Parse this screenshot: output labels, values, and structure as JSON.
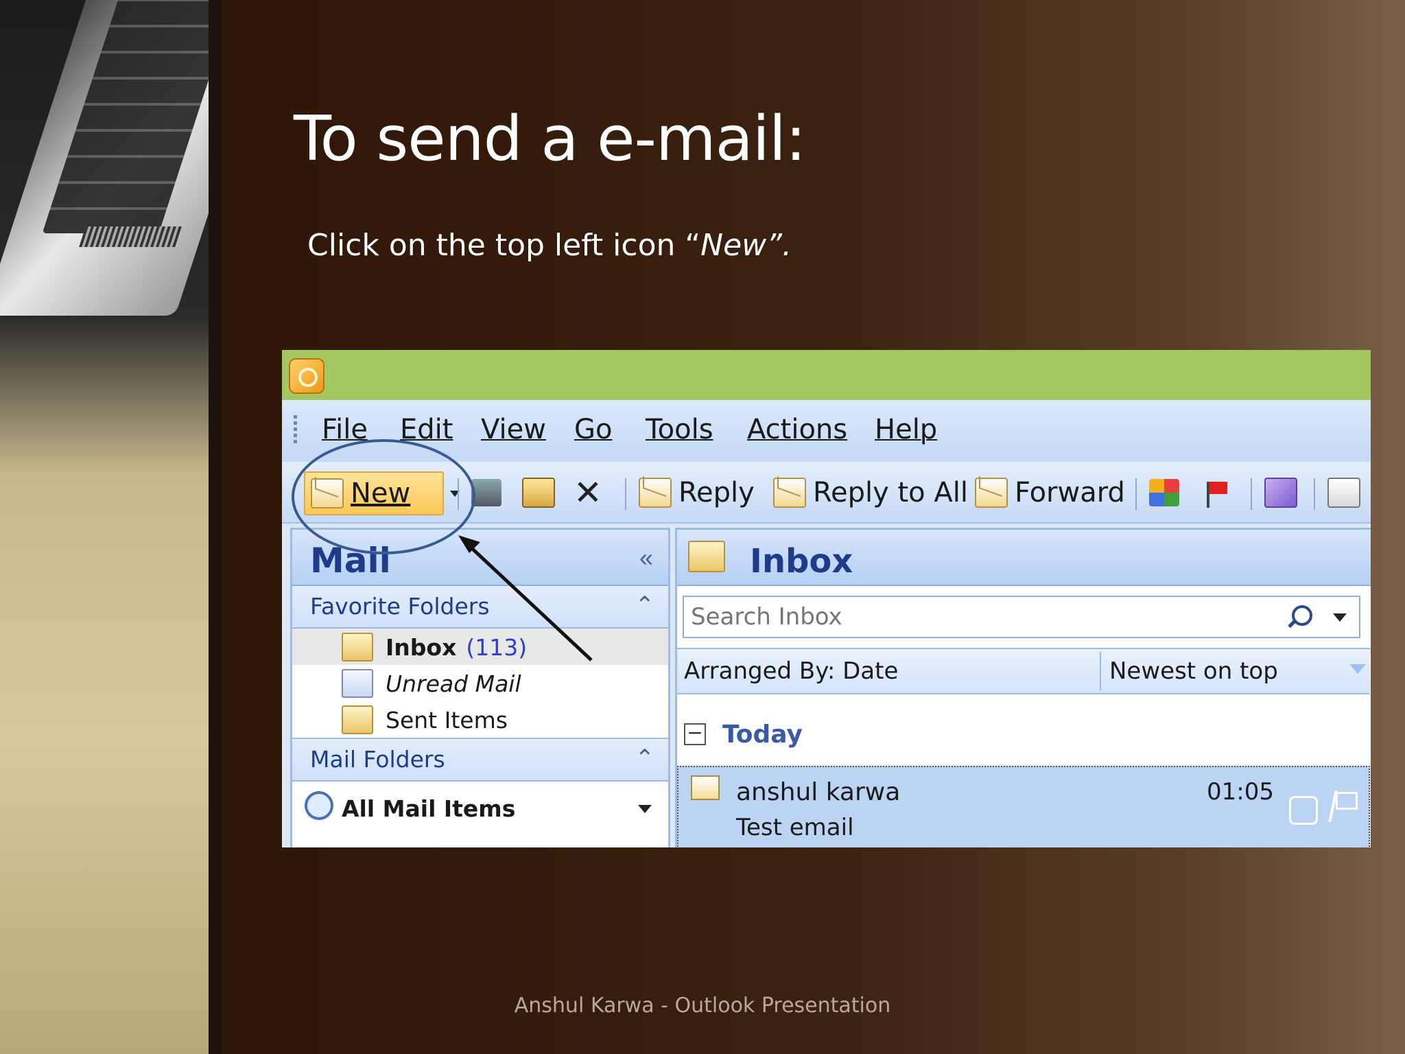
{
  "slide": {
    "title": "To send a e-mail:",
    "subtitle_prefix": "Click on the top left icon “",
    "subtitle_italic": "New”.",
    "footer": "Anshul Karwa - Outlook Presentation"
  },
  "outlook": {
    "menu": [
      "File",
      "Edit",
      "View",
      "Go",
      "Tools",
      "Actions",
      "Help"
    ],
    "toolbar": {
      "new_label": "New",
      "reply_label": "Reply",
      "reply_all_label": "Reply to All",
      "forward_label": "Forward"
    },
    "nav": {
      "title": "Mail",
      "favorites_header": "Favorite Folders",
      "favorites": {
        "inbox_label": "Inbox",
        "inbox_count": "(113)",
        "unread_label": "Unread Mail",
        "sent_label": "Sent Items"
      },
      "mail_folders_header": "Mail Folders",
      "all_mail_label": "All Mail Items"
    },
    "inbox": {
      "title": "Inbox",
      "search_placeholder": "Search Inbox",
      "arranged_by": "Arranged By: Date",
      "sort_order": "Newest on top",
      "group_label": "Today",
      "message": {
        "from": "anshul karwa",
        "time": "01:05",
        "subject": "Test email"
      }
    }
  },
  "colors": {
    "title_bar": "#a4c860",
    "annotation": "#3a5a94",
    "selected_row": "#bcd4f4"
  }
}
